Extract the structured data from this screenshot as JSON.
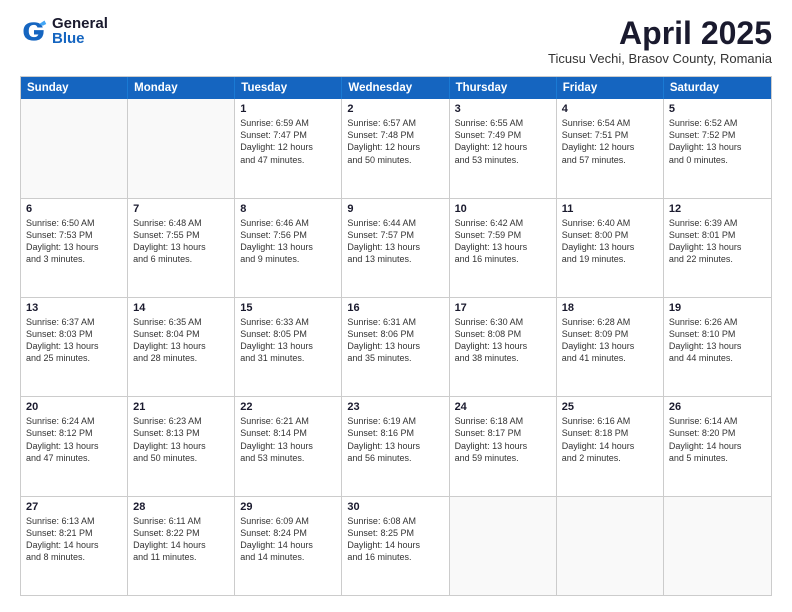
{
  "header": {
    "logo_general": "General",
    "logo_blue": "Blue",
    "month_title": "April 2025",
    "location": "Ticusu Vechi, Brasov County, Romania"
  },
  "weekdays": [
    "Sunday",
    "Monday",
    "Tuesday",
    "Wednesday",
    "Thursday",
    "Friday",
    "Saturday"
  ],
  "rows": [
    [
      {
        "day": "",
        "text": ""
      },
      {
        "day": "",
        "text": ""
      },
      {
        "day": "1",
        "text": "Sunrise: 6:59 AM\nSunset: 7:47 PM\nDaylight: 12 hours\nand 47 minutes."
      },
      {
        "day": "2",
        "text": "Sunrise: 6:57 AM\nSunset: 7:48 PM\nDaylight: 12 hours\nand 50 minutes."
      },
      {
        "day": "3",
        "text": "Sunrise: 6:55 AM\nSunset: 7:49 PM\nDaylight: 12 hours\nand 53 minutes."
      },
      {
        "day": "4",
        "text": "Sunrise: 6:54 AM\nSunset: 7:51 PM\nDaylight: 12 hours\nand 57 minutes."
      },
      {
        "day": "5",
        "text": "Sunrise: 6:52 AM\nSunset: 7:52 PM\nDaylight: 13 hours\nand 0 minutes."
      }
    ],
    [
      {
        "day": "6",
        "text": "Sunrise: 6:50 AM\nSunset: 7:53 PM\nDaylight: 13 hours\nand 3 minutes."
      },
      {
        "day": "7",
        "text": "Sunrise: 6:48 AM\nSunset: 7:55 PM\nDaylight: 13 hours\nand 6 minutes."
      },
      {
        "day": "8",
        "text": "Sunrise: 6:46 AM\nSunset: 7:56 PM\nDaylight: 13 hours\nand 9 minutes."
      },
      {
        "day": "9",
        "text": "Sunrise: 6:44 AM\nSunset: 7:57 PM\nDaylight: 13 hours\nand 13 minutes."
      },
      {
        "day": "10",
        "text": "Sunrise: 6:42 AM\nSunset: 7:59 PM\nDaylight: 13 hours\nand 16 minutes."
      },
      {
        "day": "11",
        "text": "Sunrise: 6:40 AM\nSunset: 8:00 PM\nDaylight: 13 hours\nand 19 minutes."
      },
      {
        "day": "12",
        "text": "Sunrise: 6:39 AM\nSunset: 8:01 PM\nDaylight: 13 hours\nand 22 minutes."
      }
    ],
    [
      {
        "day": "13",
        "text": "Sunrise: 6:37 AM\nSunset: 8:03 PM\nDaylight: 13 hours\nand 25 minutes."
      },
      {
        "day": "14",
        "text": "Sunrise: 6:35 AM\nSunset: 8:04 PM\nDaylight: 13 hours\nand 28 minutes."
      },
      {
        "day": "15",
        "text": "Sunrise: 6:33 AM\nSunset: 8:05 PM\nDaylight: 13 hours\nand 31 minutes."
      },
      {
        "day": "16",
        "text": "Sunrise: 6:31 AM\nSunset: 8:06 PM\nDaylight: 13 hours\nand 35 minutes."
      },
      {
        "day": "17",
        "text": "Sunrise: 6:30 AM\nSunset: 8:08 PM\nDaylight: 13 hours\nand 38 minutes."
      },
      {
        "day": "18",
        "text": "Sunrise: 6:28 AM\nSunset: 8:09 PM\nDaylight: 13 hours\nand 41 minutes."
      },
      {
        "day": "19",
        "text": "Sunrise: 6:26 AM\nSunset: 8:10 PM\nDaylight: 13 hours\nand 44 minutes."
      }
    ],
    [
      {
        "day": "20",
        "text": "Sunrise: 6:24 AM\nSunset: 8:12 PM\nDaylight: 13 hours\nand 47 minutes."
      },
      {
        "day": "21",
        "text": "Sunrise: 6:23 AM\nSunset: 8:13 PM\nDaylight: 13 hours\nand 50 minutes."
      },
      {
        "day": "22",
        "text": "Sunrise: 6:21 AM\nSunset: 8:14 PM\nDaylight: 13 hours\nand 53 minutes."
      },
      {
        "day": "23",
        "text": "Sunrise: 6:19 AM\nSunset: 8:16 PM\nDaylight: 13 hours\nand 56 minutes."
      },
      {
        "day": "24",
        "text": "Sunrise: 6:18 AM\nSunset: 8:17 PM\nDaylight: 13 hours\nand 59 minutes."
      },
      {
        "day": "25",
        "text": "Sunrise: 6:16 AM\nSunset: 8:18 PM\nDaylight: 14 hours\nand 2 minutes."
      },
      {
        "day": "26",
        "text": "Sunrise: 6:14 AM\nSunset: 8:20 PM\nDaylight: 14 hours\nand 5 minutes."
      }
    ],
    [
      {
        "day": "27",
        "text": "Sunrise: 6:13 AM\nSunset: 8:21 PM\nDaylight: 14 hours\nand 8 minutes."
      },
      {
        "day": "28",
        "text": "Sunrise: 6:11 AM\nSunset: 8:22 PM\nDaylight: 14 hours\nand 11 minutes."
      },
      {
        "day": "29",
        "text": "Sunrise: 6:09 AM\nSunset: 8:24 PM\nDaylight: 14 hours\nand 14 minutes."
      },
      {
        "day": "30",
        "text": "Sunrise: 6:08 AM\nSunset: 8:25 PM\nDaylight: 14 hours\nand 16 minutes."
      },
      {
        "day": "",
        "text": ""
      },
      {
        "day": "",
        "text": ""
      },
      {
        "day": "",
        "text": ""
      }
    ]
  ]
}
